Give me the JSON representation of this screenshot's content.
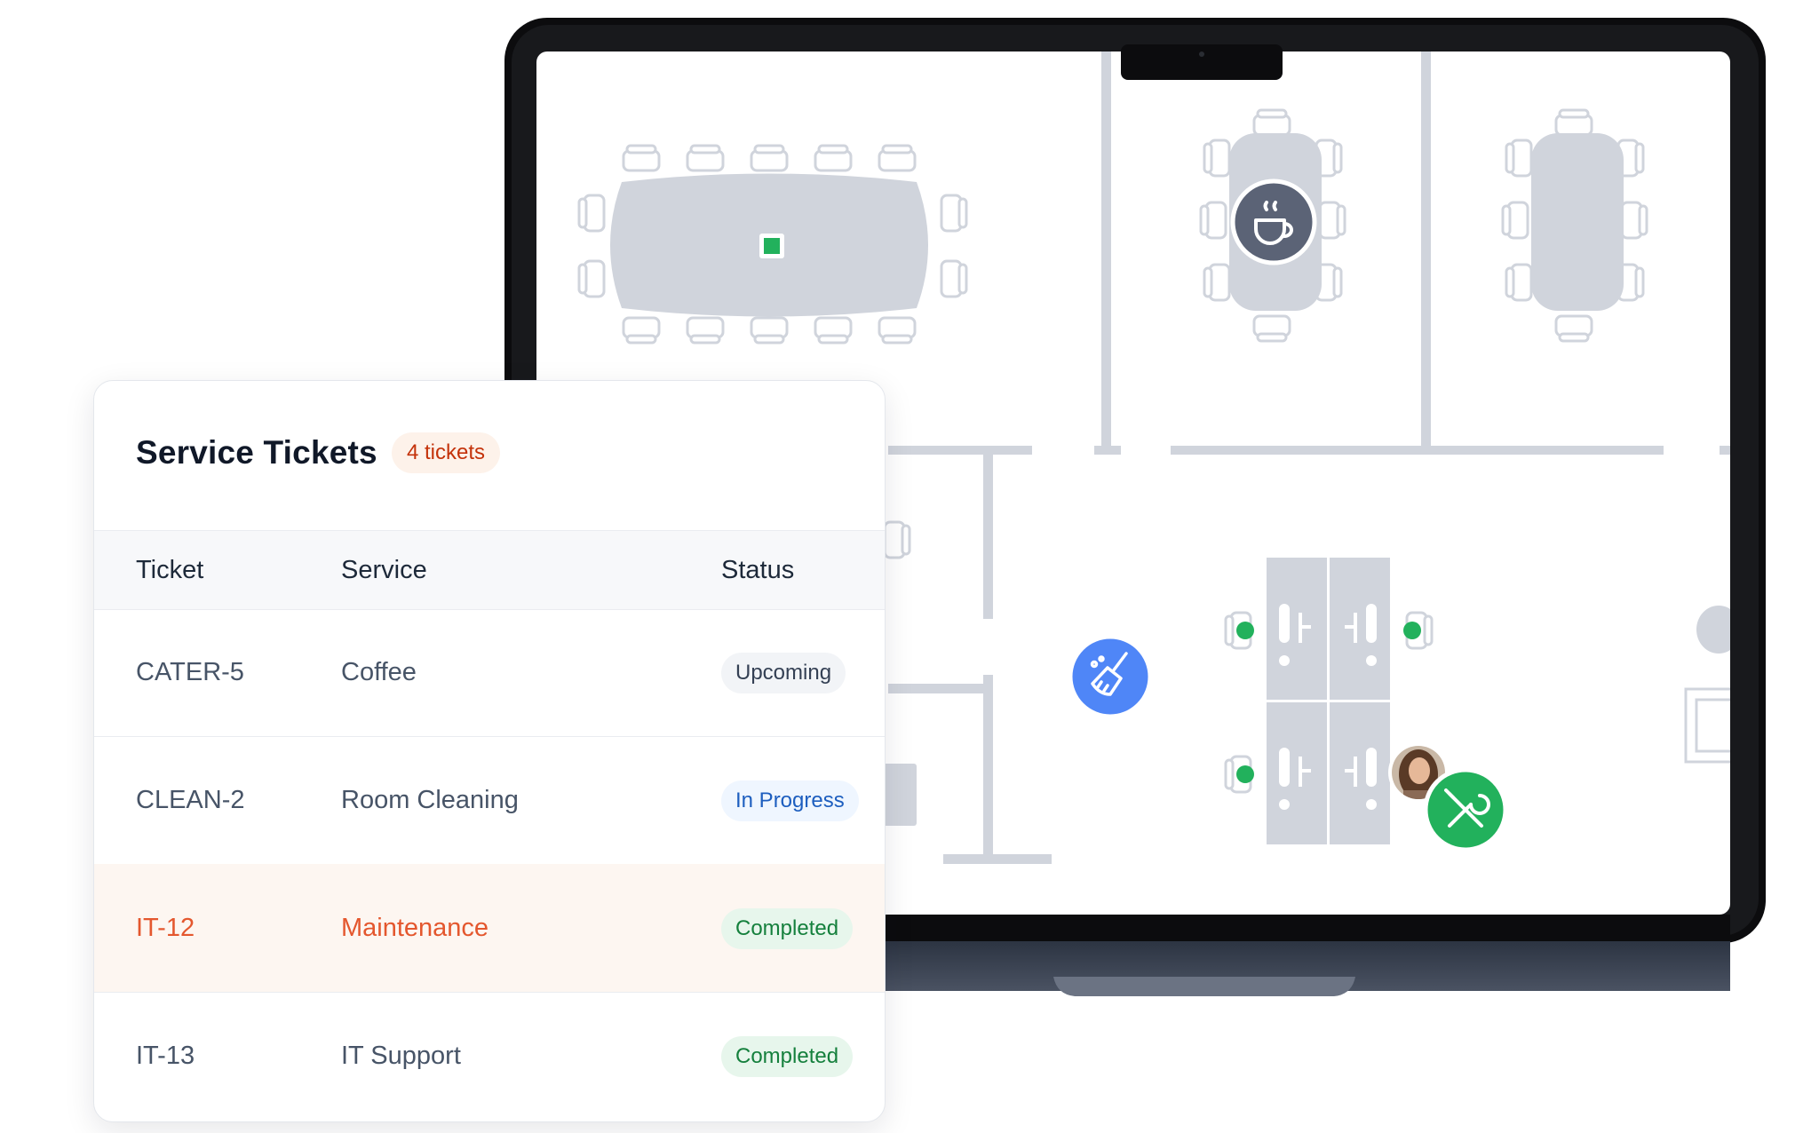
{
  "panel": {
    "title": "Service Tickets",
    "count_badge": "4 tickets",
    "columns": [
      "Ticket",
      "Service",
      "Status"
    ],
    "rows": [
      {
        "ticket": "CATER-5",
        "service": "Coffee",
        "status": "Upcoming",
        "status_bg": "#f2f4f7",
        "status_color": "#344054",
        "highlighted": false
      },
      {
        "ticket": "CLEAN-2",
        "service": "Room Cleaning",
        "status": "In Progress",
        "status_bg": "#eff6ff",
        "status_color": "#1d5ebf",
        "highlighted": false
      },
      {
        "ticket": "IT-12",
        "service": "Maintenance",
        "status": "Completed",
        "status_bg": "#e7f6ec",
        "status_color": "#15803d",
        "highlighted": true
      },
      {
        "ticket": "IT-13",
        "service": "IT Support",
        "status": "Completed",
        "status_bg": "#e7f6ec",
        "status_color": "#15803d",
        "highlighted": false
      }
    ]
  },
  "floor_plan": {
    "markers": [
      {
        "name": "coffee-service-marker",
        "icon": "coffee-cup-icon",
        "color": "#5b6376"
      },
      {
        "name": "cleaning-service-marker",
        "icon": "broom-icon",
        "color": "#4f86f7"
      },
      {
        "name": "maintenance-service-marker",
        "icon": "wrench-screwdriver-icon",
        "color": "#22b15c"
      }
    ],
    "available_color": "#22b15c"
  }
}
